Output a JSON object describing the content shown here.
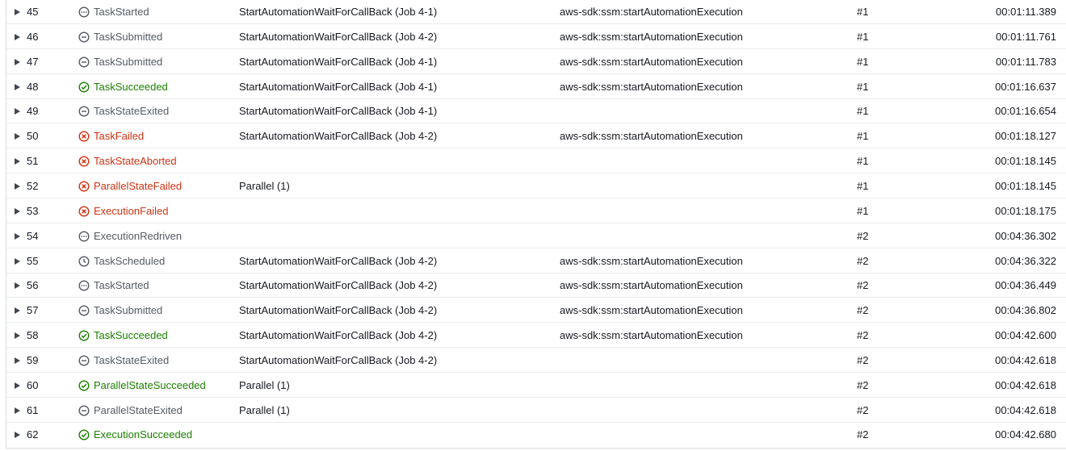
{
  "colors": {
    "gray": "#545b64",
    "green": "#1d8102",
    "red": "#d13212"
  },
  "events": [
    {
      "id": "45",
      "type": "TaskStarted",
      "status": "gray",
      "icon": "in-progress-icon",
      "state": "StartAutomationWaitForCallBack (Job 4-1)",
      "resource": "aws-sdk:ssm:startAutomationExecution",
      "redrive": "#1",
      "elapsed": "00:01:11.389"
    },
    {
      "id": "46",
      "type": "TaskSubmitted",
      "status": "gray",
      "icon": "minus-circle-icon",
      "state": "StartAutomationWaitForCallBack (Job 4-2)",
      "resource": "aws-sdk:ssm:startAutomationExecution",
      "redrive": "#1",
      "elapsed": "00:01:11.761"
    },
    {
      "id": "47",
      "type": "TaskSubmitted",
      "status": "gray",
      "icon": "minus-circle-icon",
      "state": "StartAutomationWaitForCallBack (Job 4-1)",
      "resource": "aws-sdk:ssm:startAutomationExecution",
      "redrive": "#1",
      "elapsed": "00:01:11.783"
    },
    {
      "id": "48",
      "type": "TaskSucceeded",
      "status": "green",
      "icon": "check-circle-icon",
      "state": "StartAutomationWaitForCallBack (Job 4-1)",
      "resource": "aws-sdk:ssm:startAutomationExecution",
      "redrive": "#1",
      "elapsed": "00:01:16.637"
    },
    {
      "id": "49",
      "type": "TaskStateExited",
      "status": "gray",
      "icon": "minus-circle-icon",
      "state": "StartAutomationWaitForCallBack (Job 4-1)",
      "resource": "",
      "redrive": "#1",
      "elapsed": "00:01:16.654"
    },
    {
      "id": "50",
      "type": "TaskFailed",
      "status": "red",
      "icon": "x-circle-icon",
      "state": "StartAutomationWaitForCallBack (Job 4-2)",
      "resource": "aws-sdk:ssm:startAutomationExecution",
      "redrive": "#1",
      "elapsed": "00:01:18.127"
    },
    {
      "id": "51",
      "type": "TaskStateAborted",
      "status": "red",
      "icon": "x-circle-icon",
      "state": "",
      "resource": "",
      "redrive": "#1",
      "elapsed": "00:01:18.145"
    },
    {
      "id": "52",
      "type": "ParallelStateFailed",
      "status": "red",
      "icon": "x-circle-icon",
      "state": "Parallel (1)",
      "resource": "",
      "redrive": "#1",
      "elapsed": "00:01:18.145"
    },
    {
      "id": "53",
      "type": "ExecutionFailed",
      "status": "red",
      "icon": "x-circle-icon",
      "state": "",
      "resource": "",
      "redrive": "#1",
      "elapsed": "00:01:18.175"
    },
    {
      "id": "54",
      "type": "ExecutionRedriven",
      "status": "gray",
      "icon": "in-progress-icon",
      "state": "",
      "resource": "",
      "redrive": "#2",
      "elapsed": "00:04:36.302"
    },
    {
      "id": "55",
      "type": "TaskScheduled",
      "status": "gray",
      "icon": "clock-icon",
      "state": "StartAutomationWaitForCallBack (Job 4-2)",
      "resource": "aws-sdk:ssm:startAutomationExecution",
      "redrive": "#2",
      "elapsed": "00:04:36.322"
    },
    {
      "id": "56",
      "type": "TaskStarted",
      "status": "gray",
      "icon": "in-progress-icon",
      "state": "StartAutomationWaitForCallBack (Job 4-2)",
      "resource": "aws-sdk:ssm:startAutomationExecution",
      "redrive": "#2",
      "elapsed": "00:04:36.449"
    },
    {
      "id": "57",
      "type": "TaskSubmitted",
      "status": "gray",
      "icon": "minus-circle-icon",
      "state": "StartAutomationWaitForCallBack (Job 4-2)",
      "resource": "aws-sdk:ssm:startAutomationExecution",
      "redrive": "#2",
      "elapsed": "00:04:36.802"
    },
    {
      "id": "58",
      "type": "TaskSucceeded",
      "status": "green",
      "icon": "check-circle-icon",
      "state": "StartAutomationWaitForCallBack (Job 4-2)",
      "resource": "aws-sdk:ssm:startAutomationExecution",
      "redrive": "#2",
      "elapsed": "00:04:42.600"
    },
    {
      "id": "59",
      "type": "TaskStateExited",
      "status": "gray",
      "icon": "minus-circle-icon",
      "state": "StartAutomationWaitForCallBack (Job 4-2)",
      "resource": "",
      "redrive": "#2",
      "elapsed": "00:04:42.618"
    },
    {
      "id": "60",
      "type": "ParallelStateSucceeded",
      "status": "green",
      "icon": "check-circle-icon",
      "state": "Parallel (1)",
      "resource": "",
      "redrive": "#2",
      "elapsed": "00:04:42.618"
    },
    {
      "id": "61",
      "type": "ParallelStateExited",
      "status": "gray",
      "icon": "minus-circle-icon",
      "state": "Parallel (1)",
      "resource": "",
      "redrive": "#2",
      "elapsed": "00:04:42.618"
    },
    {
      "id": "62",
      "type": "ExecutionSucceeded",
      "status": "green",
      "icon": "check-circle-icon",
      "state": "",
      "resource": "",
      "redrive": "#2",
      "elapsed": "00:04:42.680"
    }
  ]
}
